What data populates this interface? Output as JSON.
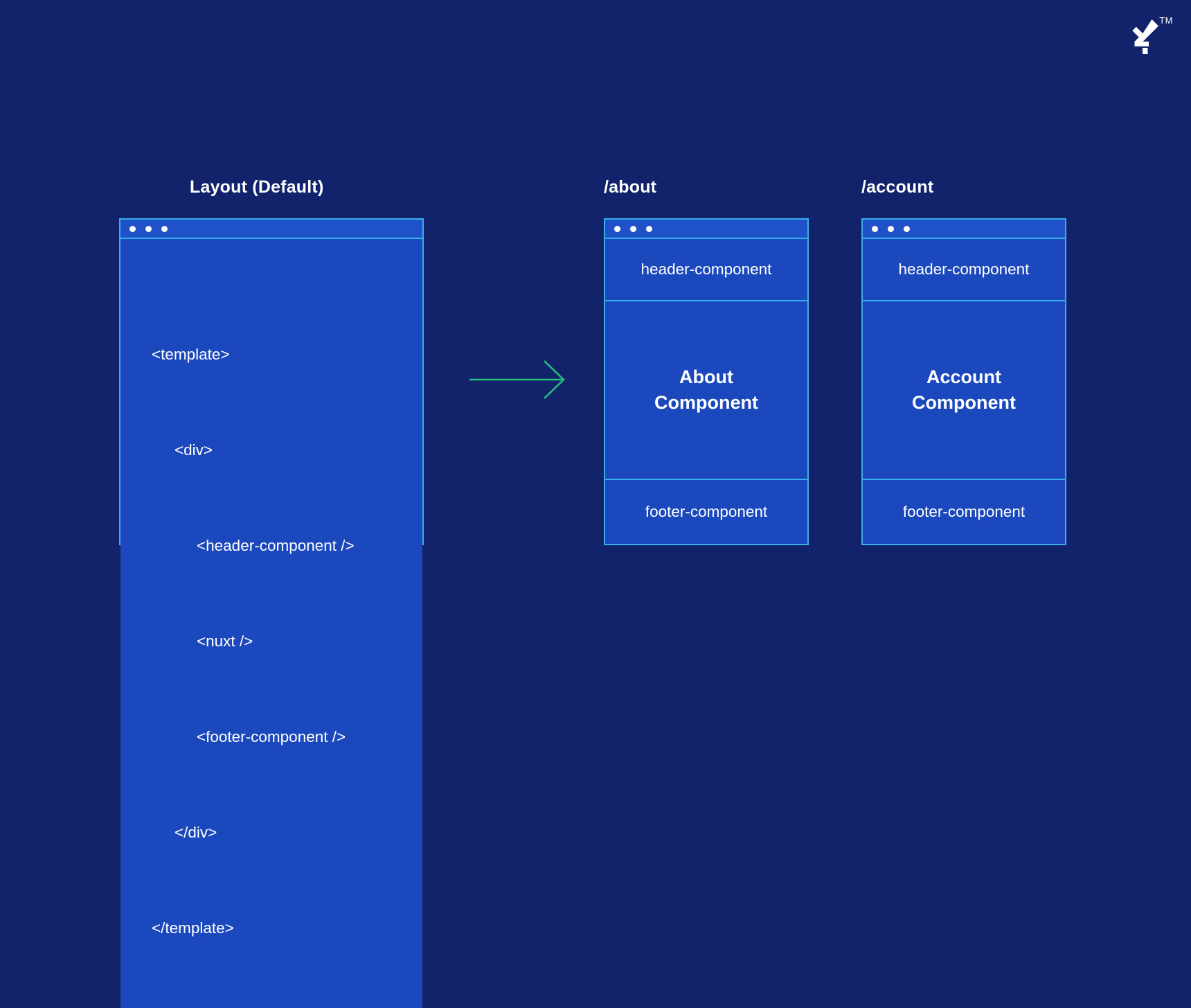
{
  "brand": {
    "logo_icon": "toptal-logo-icon",
    "trademark": "TM",
    "logo_color": "#ffffff"
  },
  "colors": {
    "background": "#12236b",
    "panel_fill": "#1b49bd",
    "panel_border": "#3aaeea",
    "titlebar_fill": "#1f51c9",
    "arrow": "#22c07a",
    "text": "#ffffff"
  },
  "diagram": {
    "type": "nuxt-layout-routing-diagram",
    "arrow_icon": "arrow-right-icon"
  },
  "layout_panel": {
    "caption": "Layout (Default)",
    "window_dots": 3,
    "code_lines": [
      {
        "text": "<template>",
        "indent": 0
      },
      {
        "text": "<div>",
        "indent": 1
      },
      {
        "text": "<header-component />",
        "indent": 2
      },
      {
        "text": "<nuxt />",
        "indent": 2
      },
      {
        "text": "<footer-component />",
        "indent": 2
      },
      {
        "text": "</div>",
        "indent": 1
      },
      {
        "text": "</template>",
        "indent": 0
      }
    ]
  },
  "route_panels": [
    {
      "caption": "/about",
      "window_dots": 3,
      "header": "header-component",
      "main": "About\nComponent",
      "main_line1": "About",
      "main_line2": "Component",
      "footer": "footer-component"
    },
    {
      "caption": "/account",
      "window_dots": 3,
      "header": "header-component",
      "main": "Account\nComponent",
      "main_line1": "Account",
      "main_line2": "Component",
      "footer": "footer-component"
    }
  ]
}
